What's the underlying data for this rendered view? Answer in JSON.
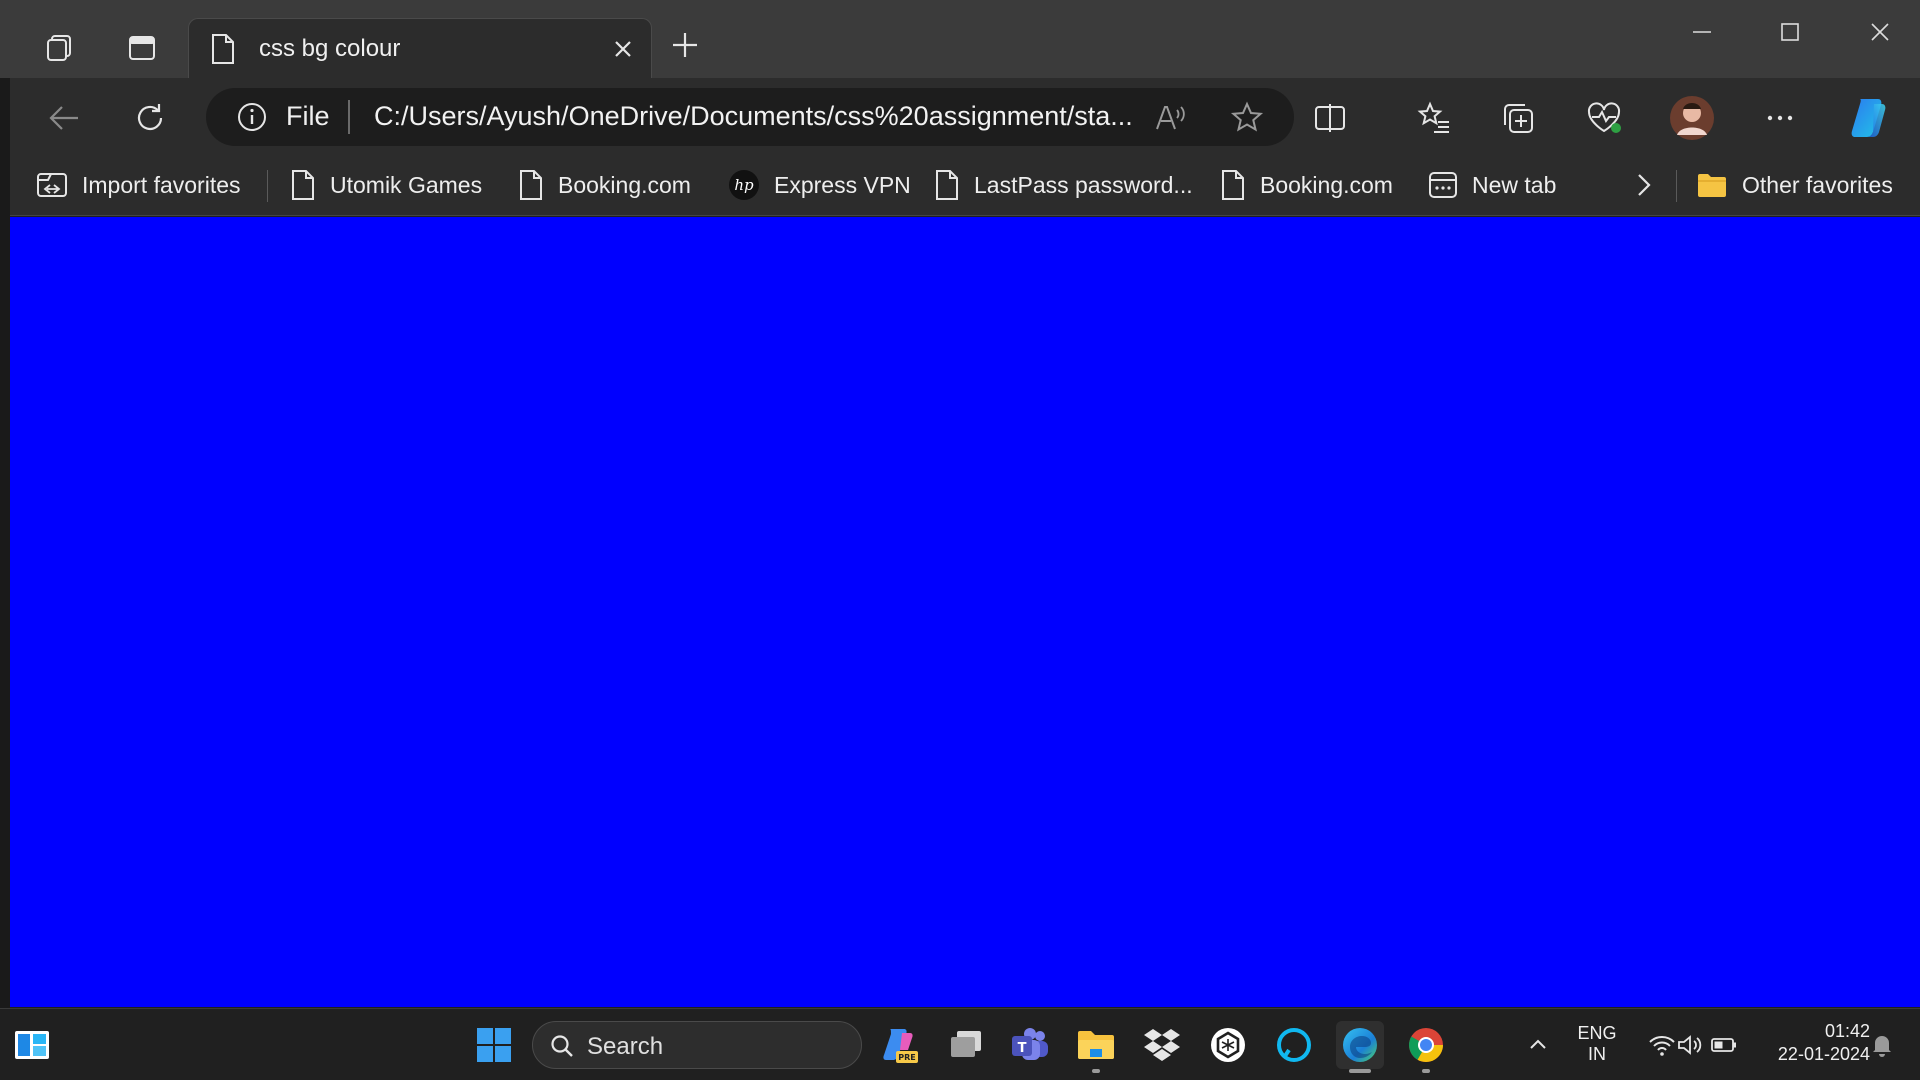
{
  "colors": {
    "page_background": "#0000ff",
    "chrome_dark": "#2c2c2c",
    "tab_strip": "#3b3b3b"
  },
  "tab": {
    "title": "css bg colour",
    "icon": "page-icon"
  },
  "toolbar": {
    "address_scheme": "File",
    "address_url": "C:/Users/Ayush/OneDrive/Documents/css%20assignment/sta..."
  },
  "favorites": [
    {
      "label": "Import favorites",
      "icon": "import-icon"
    },
    {
      "label": "Utomik Games",
      "icon": "page-icon"
    },
    {
      "label": "Booking.com",
      "icon": "page-icon"
    },
    {
      "label": "Express VPN",
      "icon": "hp-logo-icon"
    },
    {
      "label": "LastPass password...",
      "icon": "page-icon"
    },
    {
      "label": "Booking.com",
      "icon": "page-icon"
    },
    {
      "label": "New tab",
      "icon": "new-tab-icon"
    }
  ],
  "other_favorites": "Other favorites",
  "taskbar": {
    "search_placeholder": "Search",
    "lang_line1": "ENG",
    "lang_line2": "IN",
    "time": "01:42",
    "date": "22-01-2024"
  }
}
